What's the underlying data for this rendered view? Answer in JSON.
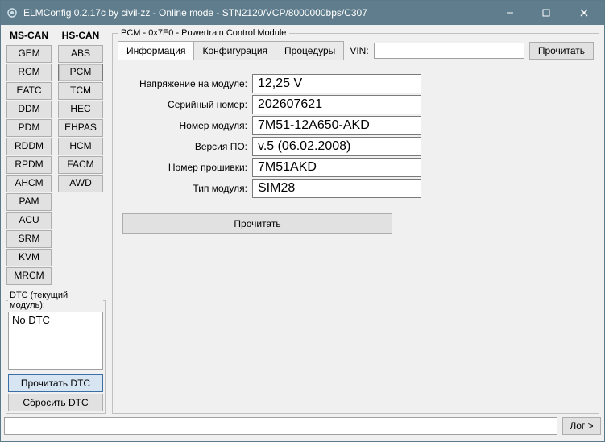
{
  "window": {
    "title": "ELMConfig 0.2.17c by civil-zz - Online mode - STN2120/VCP/8000000bps/C307"
  },
  "left": {
    "mscan_header": "MS-CAN",
    "hscan_header": "HS-CAN",
    "mscan": [
      "GEM",
      "RCM",
      "EATC",
      "DDM",
      "PDM",
      "RDDM",
      "RPDM",
      "AHCM",
      "PAM",
      "ACU",
      "SRM",
      "KVM",
      "MRCM"
    ],
    "hscan": [
      "ABS",
      "PCM",
      "TCM",
      "HEC",
      "EHPAS",
      "HCM",
      "FACM",
      "AWD"
    ],
    "selected": "PCM",
    "dtc_legend": "DTC (текущий модуль):",
    "dtc_text": "No DTC",
    "read_dtc": "Прочитать DTC",
    "reset_dtc": "Сбросить DTC"
  },
  "module": {
    "legend": "PCM - 0x7E0 - Powertrain Control Module",
    "tabs": [
      "Информация",
      "Конфигурация",
      "Процедуры"
    ],
    "active_tab": 0,
    "vin_label": "VIN:",
    "vin_value": "",
    "read_label": "Прочитать",
    "rows": [
      {
        "label": "Напряжение на модуле:",
        "value": "12,25 V"
      },
      {
        "label": "Серийный номер:",
        "value": "202607621"
      },
      {
        "label": "Номер модуля:",
        "value": "7M51-12A650-AKD"
      },
      {
        "label": "Версия ПО:",
        "value": "v.5 (06.02.2008)"
      },
      {
        "label": "Номер прошивки:",
        "value": "7M51AKD"
      },
      {
        "label": "Тип модуля:",
        "value": "SIM28"
      }
    ],
    "big_read": "Прочитать"
  },
  "bottom": {
    "log_value": "",
    "log_btn": "Лог >"
  }
}
